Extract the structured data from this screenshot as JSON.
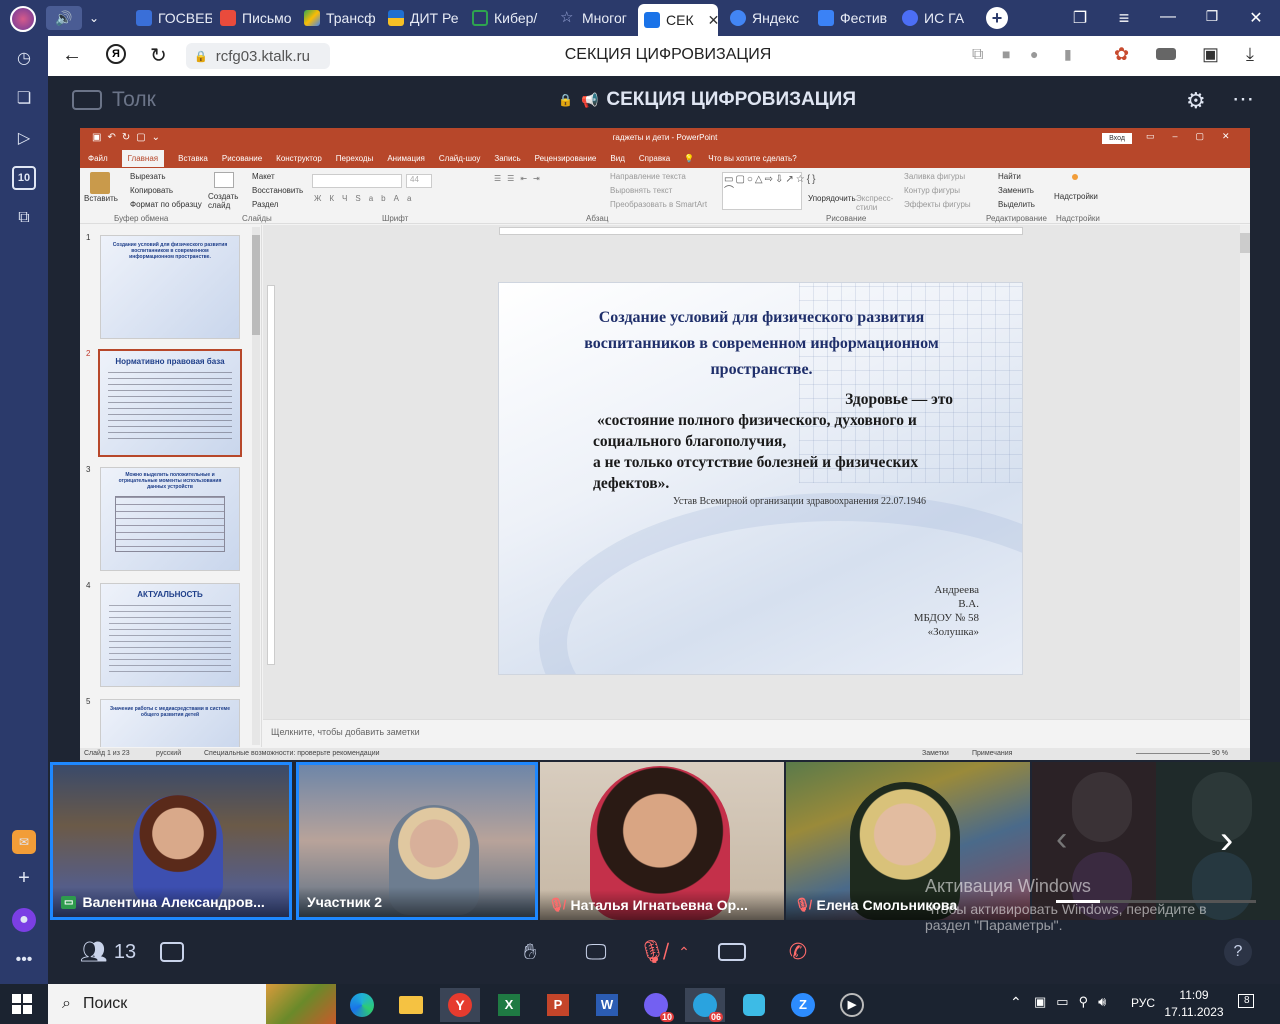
{
  "browser": {
    "tabs": [
      {
        "label": "ГОСВЕБ",
        "color": "#3a6fd8"
      },
      {
        "label": "Письмо",
        "color": "#e94b3c"
      },
      {
        "label": "Трансф",
        "color": "#34a853"
      },
      {
        "label": "ДИТ Ре",
        "color": "#f6c026"
      },
      {
        "label": "Кибер/",
        "color": "#2ea44f"
      },
      {
        "label": "Многог",
        "color": "#9aa7d9"
      },
      {
        "label": "СЕК",
        "color": "#1a73e8"
      },
      {
        "label": "Яндекс",
        "color": "#4285f4"
      },
      {
        "label": "Фестив",
        "color": "#3b82f6"
      },
      {
        "label": "ИС ГА",
        "color": "#4c6ef5"
      }
    ],
    "url": "rcfg03.ktalk.ru",
    "page_title": "СЕКЦИЯ ЦИФРОВИЗАЦИЯ",
    "rail_badge": "10"
  },
  "app": {
    "brand": "Толк",
    "room_title": "СЕКЦИЯ ЦИФРОВИЗАЦИЯ"
  },
  "powerpoint": {
    "window_title": "гаджеты и дети - PowerPoint",
    "signin": "Вход",
    "menu": [
      "Файл",
      "Главная",
      "Вставка",
      "Рисование",
      "Конструктор",
      "Переходы",
      "Анимация",
      "Слайд-шоу",
      "Запись",
      "Рецензирование",
      "Вид",
      "Справка"
    ],
    "tell_me": "Что вы хотите сделать?",
    "clipboard": {
      "paste": "Вставить",
      "cut": "Вырезать",
      "copy": "Копировать",
      "format": "Формат по образцу",
      "group": "Буфер обмена"
    },
    "slides_group": {
      "create": "Создать слайд",
      "layout": "Макет",
      "restore": "Восстановить",
      "section": "Раздел",
      "group": "Слайды"
    },
    "font_group": {
      "size": "44",
      "group": "Шрифт"
    },
    "paragraph_group": {
      "direction": "Направление текста",
      "align": "Выровнять текст",
      "smartart": "Преобразовать в SmartArt",
      "group": "Абзац"
    },
    "drawing_group": {
      "arrange": "Упорядочить",
      "styles": "Экспресс-стили",
      "fill": "Заливка фигуры",
      "outline": "Контур фигуры",
      "effects": "Эффекты фигуры",
      "group": "Рисование"
    },
    "editing_group": {
      "find": "Найти",
      "replace": "Заменить",
      "select": "Выделить",
      "group": "Редактирование"
    },
    "addins_group": {
      "addins": "Надстройки",
      "group": "Надстройки"
    },
    "thumbnails": [
      {
        "num": "1",
        "title": "Создание условий для физического развития воспитанников в современном информационном пространстве."
      },
      {
        "num": "2",
        "title": "Нормативно правовая база"
      },
      {
        "num": "3",
        "title": "Можно выделить положительные и отрицательные моменты использования данных устройств"
      },
      {
        "num": "4",
        "title": "АКТУАЛЬНОСТЬ"
      },
      {
        "num": "5",
        "title": "Значение работы с медиасредствами в системе общего развития детей"
      }
    ],
    "slide": {
      "title_line1": "Создание  условий  для  физического  развития",
      "title_line2": "воспитанников  в современном  информационном",
      "title_line3": "пространстве.",
      "quote_line1": "Здоровье — это",
      "quote_line2": "«состояние полного физического, духовного и",
      "quote_line3": "социального благополучия,",
      "quote_line4": "а не только отсутствие болезней и физических",
      "quote_line5": "дефектов».",
      "source": "Устав Всемирной организации здравоохранения  22.07.1946",
      "author_line1": "Андреева",
      "author_line2": "В.А.",
      "author_line3": "МБДОУ № 58",
      "author_line4": "«Золушка»"
    },
    "notes_placeholder": "Щелкните, чтобы добавить заметки",
    "status": {
      "slide_count": "Слайд 1 из 23",
      "language": "русский",
      "accessibility": "Специальные возможности: проверьте рекомендации",
      "notes": "Заметки",
      "comments": "Примечания",
      "zoom": "90 %"
    }
  },
  "participants": [
    {
      "name": "Валентина Александров...",
      "speaking": true
    },
    {
      "name": "Участник 2",
      "speaking": false
    },
    {
      "name": "Наталья Игнатьевна Ор...",
      "speaking": false
    },
    {
      "name": "Елена Смольникова",
      "speaking": false
    }
  ],
  "watermark": {
    "title": "Активация Windows",
    "line1": "Чтобы активировать Windows, перейдите в",
    "line2": "раздел \"Параметры\"."
  },
  "controls": {
    "participants_count": "13",
    "help": "?"
  },
  "taskbar": {
    "search": "Поиск",
    "viber_badge": "10",
    "telegram_badge": "06",
    "lang": "РУС",
    "time": "11:09",
    "date": "17.11.2023",
    "notifications": "8"
  }
}
